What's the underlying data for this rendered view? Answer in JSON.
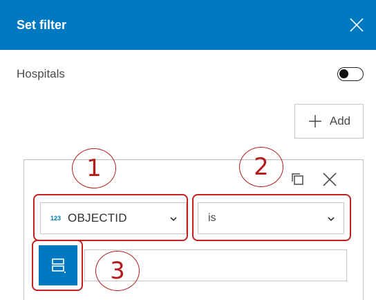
{
  "dialog": {
    "title": "Set filter",
    "accent": "#0079c1"
  },
  "layer": {
    "name": "Hospitals",
    "filter_enabled": false
  },
  "toolbar": {
    "add_label": "Add"
  },
  "expression": {
    "field_type": "123",
    "field_name": "OBJECTID",
    "operator": "is",
    "value": "",
    "value_mode_icon": "list-icon"
  },
  "annotations": {
    "callout_color": "#c41e1e",
    "steps": [
      "1",
      "2",
      "3"
    ]
  },
  "icons": {
    "close": "close-icon",
    "add": "plus-icon",
    "duplicate": "duplicate-icon",
    "delete": "close-icon",
    "dropdown": "chevron-down-icon"
  }
}
